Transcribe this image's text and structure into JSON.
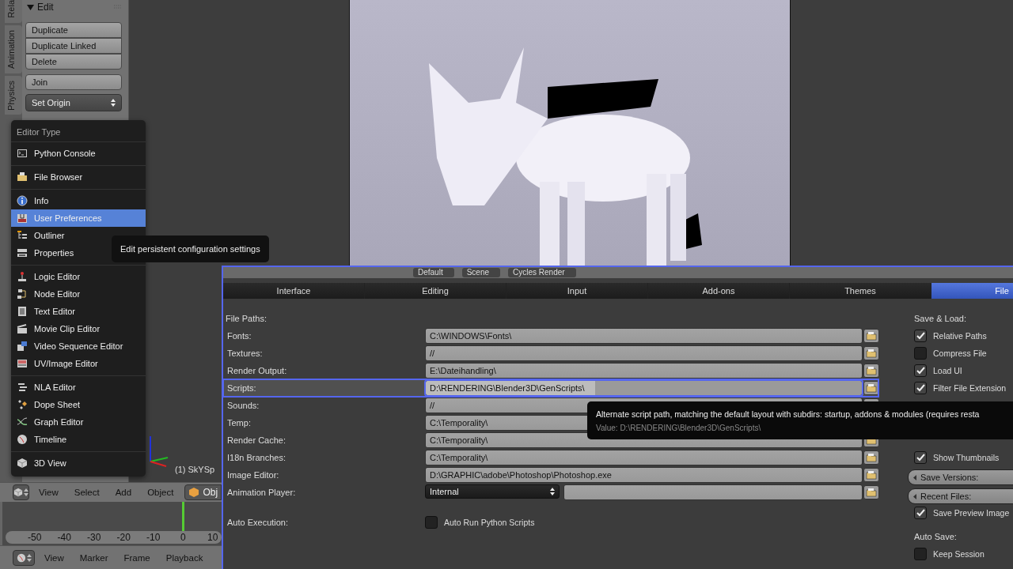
{
  "toolshelf": {
    "tabs": [
      "Rela",
      "Animation",
      "Physics"
    ],
    "panel": {
      "title": "Edit",
      "expanded": true,
      "button_group": [
        "Duplicate",
        "Duplicate Linked",
        "Delete"
      ],
      "join": "Join",
      "set_origin": "Set Origin"
    }
  },
  "editor_menu": {
    "title": "Editor Type",
    "groups": [
      [
        {
          "label": "Python Console",
          "selected": false
        }
      ],
      [
        {
          "label": "File Browser",
          "selected": false
        }
      ],
      [
        {
          "label": "Info",
          "selected": false
        },
        {
          "label": "User Preferences",
          "selected": true
        },
        {
          "label": "Outliner",
          "selected": false
        },
        {
          "label": "Properties",
          "selected": false
        }
      ],
      [
        {
          "label": "Logic Editor",
          "selected": false
        },
        {
          "label": "Node Editor",
          "selected": false
        },
        {
          "label": "Text Editor",
          "selected": false
        },
        {
          "label": "Movie Clip Editor",
          "selected": false
        },
        {
          "label": "Video Sequence Editor",
          "selected": false
        },
        {
          "label": "UV/Image Editor",
          "selected": false
        }
      ],
      [
        {
          "label": "NLA Editor",
          "selected": false
        },
        {
          "label": "Dope Sheet",
          "selected": false
        },
        {
          "label": "Graph Editor",
          "selected": false
        },
        {
          "label": "Timeline",
          "selected": false
        }
      ],
      [
        {
          "label": "3D View",
          "selected": false
        }
      ]
    ]
  },
  "menu_tooltip": "Edit persistent configuration settings",
  "viewport": {
    "object_label": "(1) SkYSp"
  },
  "view3d_header": {
    "menus": [
      "View",
      "Select",
      "Add",
      "Object"
    ],
    "mode": "Obj"
  },
  "timeline": {
    "ticks": [
      {
        "label": "-50",
        "current": false
      },
      {
        "label": "-40",
        "current": false
      },
      {
        "label": "-30",
        "current": false
      },
      {
        "label": "-20",
        "current": false
      },
      {
        "label": "-10",
        "current": false
      },
      {
        "label": "0",
        "current": true
      },
      {
        "label": "10",
        "current": false
      }
    ]
  },
  "timeline_header": {
    "menus": [
      "View",
      "Marker",
      "Frame",
      "Playback"
    ]
  },
  "info_header": {
    "layout": "Default",
    "scene": "Scene",
    "engine": "Cycles Render"
  },
  "preferences": {
    "tabs": [
      {
        "label": "Interface",
        "selected": false
      },
      {
        "label": "Editing",
        "selected": false
      },
      {
        "label": "Input",
        "selected": false
      },
      {
        "label": "Add-ons",
        "selected": false
      },
      {
        "label": "Themes",
        "selected": false
      },
      {
        "label": "File",
        "selected": true
      }
    ],
    "file_paths_heading": "File Paths:",
    "paths": [
      {
        "kind": "path",
        "label": "Fonts:",
        "value": "C:\\WINDOWS\\Fonts\\",
        "highlighted": false
      },
      {
        "kind": "path",
        "label": "Textures:",
        "value": "//",
        "highlighted": false
      },
      {
        "kind": "path",
        "label": "Render Output:",
        "value": "E:\\Dateihandling\\",
        "highlighted": false
      },
      {
        "kind": "path",
        "label": "Scripts:",
        "value": "D:\\RENDERING\\Blender3D\\GenScripts\\",
        "highlighted": true
      },
      {
        "kind": "path",
        "label": "Sounds:",
        "value": "//",
        "highlighted": false
      },
      {
        "kind": "path",
        "label": "Temp:",
        "value": "C:\\Temporality\\",
        "highlighted": false
      },
      {
        "kind": "path",
        "label": "Render Cache:",
        "value": "C:\\Temporality\\",
        "highlighted": false
      },
      {
        "kind": "path",
        "label": "I18n Branches:",
        "value": "C:\\Temporality\\",
        "highlighted": false
      },
      {
        "kind": "path",
        "label": "Image Editor:",
        "value": "D:\\GRAPHIC\\adobe\\Photoshop\\Photoshop.exe",
        "highlighted": false
      },
      {
        "kind": "dropdown",
        "label": "Animation Player:",
        "value": "Internal",
        "highlighted": false
      }
    ],
    "auto_execution": {
      "label": "Auto Execution:",
      "option": {
        "label": "Auto Run Python Scripts",
        "checked": false
      }
    },
    "save_load_heading": "Save & Load:",
    "save_load": [
      {
        "kind": "checkbox",
        "label": "Relative Paths",
        "checked": true
      },
      {
        "kind": "checkbox",
        "label": "Compress File",
        "checked": false
      },
      {
        "kind": "checkbox",
        "label": "Load UI",
        "checked": true
      },
      {
        "kind": "checkbox",
        "label": "Filter File Extension",
        "checked": true
      }
    ],
    "more_options": [
      {
        "kind": "checkbox",
        "label": "Show Thumbnails",
        "checked": true
      },
      {
        "kind": "number",
        "label": "Save Versions:"
      },
      {
        "kind": "number",
        "label": "Recent Files:"
      },
      {
        "kind": "checkbox",
        "label": "Save Preview Image",
        "checked": true
      }
    ],
    "auto_save_heading": "Auto Save:",
    "auto_save": [
      {
        "kind": "checkbox",
        "label": "Keep Session",
        "checked": false
      }
    ],
    "tooltip": {
      "description": "Alternate script path, matching the default layout with subdirs: startup, addons & modules (requires resta",
      "value": "Value: D:\\RENDERING\\Blender3D\\GenScripts\\"
    }
  }
}
